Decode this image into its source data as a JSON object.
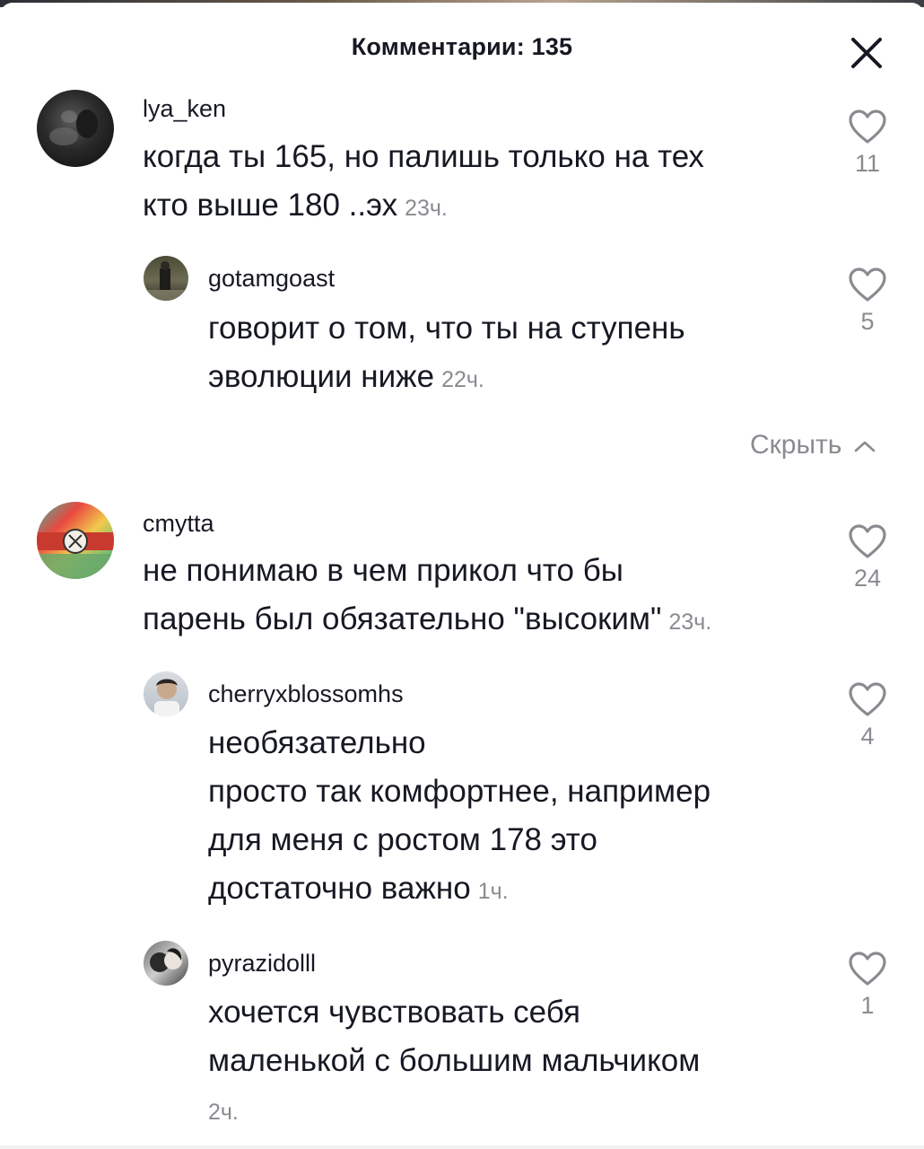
{
  "header": {
    "title": "Комментарии: 135",
    "close_icon": "close-icon"
  },
  "comments": [
    {
      "username": "lya_ken",
      "lines": [
        "когда ты 165, но палишь только на тех",
        "кто выше 180 ..эх"
      ],
      "time": "23ч.",
      "likes": "11",
      "avatar": "avatar-dark-photo",
      "replies": [
        {
          "username": "gotamgoast",
          "lines": [
            "говорит о том, что ты на ступень",
            "эволюции ниже"
          ],
          "time": "22ч.",
          "likes": "5",
          "avatar": "avatar-person-photo"
        }
      ]
    },
    {
      "username": "cmytta",
      "lines": [
        "не понимаю в чем прикол что бы",
        "парень был обязательно \"высоким\""
      ],
      "time": "23ч.",
      "likes": "24",
      "avatar": "avatar-colorful-sign",
      "replies": [
        {
          "username": "cherryxblossomhs",
          "lines": [
            "необязательно",
            "просто так комфортнее, например",
            "для меня с ростом 178 это",
            "достаточно важно"
          ],
          "time": "1ч.",
          "likes": "4",
          "avatar": "avatar-portrait-photo"
        },
        {
          "username": "pyrazidolll",
          "lines": [
            "хочется чувствовать себя",
            "маленькой с большим мальчиком"
          ],
          "time": "2ч.",
          "likes": "1",
          "avatar": "avatar-couple-photo"
        }
      ]
    }
  ],
  "hide_replies": {
    "label": "Скрыть",
    "icon": "chevron-up-icon"
  },
  "like_icon": "heart-outline-icon",
  "colors": {
    "text": "#161823",
    "secondary": "#8a8b91",
    "background": "#ffffff"
  }
}
